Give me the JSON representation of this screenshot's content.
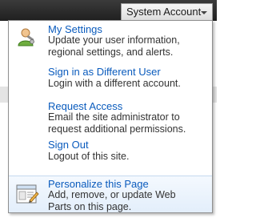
{
  "header": {
    "account_label": "System Account"
  },
  "menu": {
    "items": [
      {
        "title": "My Settings",
        "description": "Update your user information, regional settings, and alerts.",
        "icon": "user-settings-icon"
      },
      {
        "title": "Sign in as Different User",
        "description": "Login with a different account.",
        "icon": ""
      },
      {
        "title": "Request Access",
        "description": "Email the site administrator to request additional permissions.",
        "icon": ""
      },
      {
        "title": "Sign Out",
        "description": "Logout of this site.",
        "icon": ""
      },
      {
        "title": "Personalize this Page",
        "description": "Add, remove, or update Web Parts on this page.",
        "icon": "personalize-page-icon"
      }
    ]
  },
  "colors": {
    "link": "#0a5bbd",
    "text": "#333333",
    "highlight": "#e3eefb",
    "topbar": "#2b2b2b"
  }
}
